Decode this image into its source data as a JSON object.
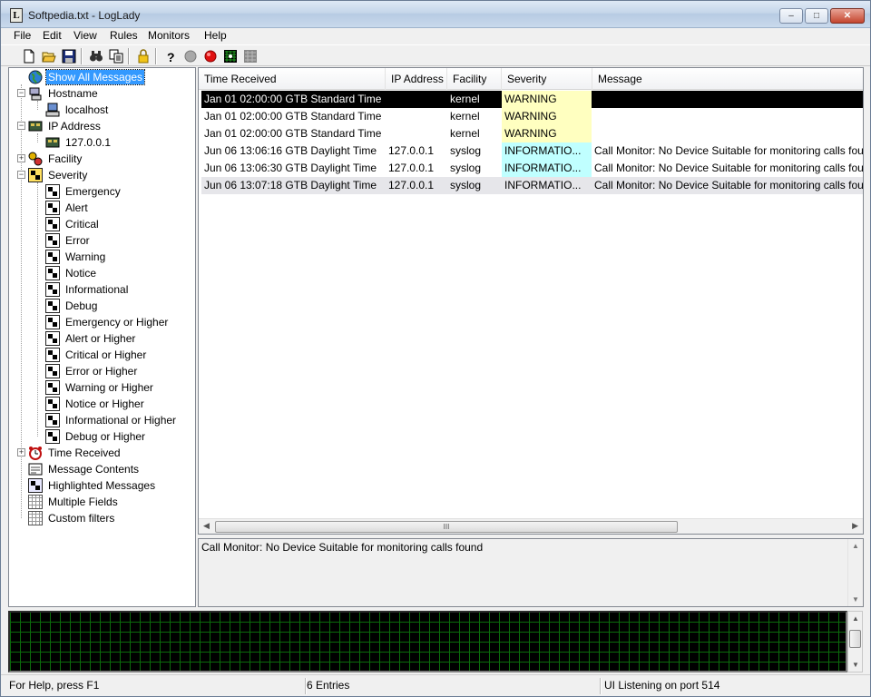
{
  "window": {
    "title": "Softpedia.txt - LogLady",
    "minimize_label": "‒",
    "maximize_label": "□",
    "close_label": "✕"
  },
  "menu": [
    "File",
    "Edit",
    "View",
    "Rules",
    "Monitors",
    "Help"
  ],
  "toolbar": {
    "icons": [
      "new-file-icon",
      "open-folder-icon",
      "save-icon",
      "find-icon",
      "copy-icon",
      "lock-icon",
      "help-icon",
      "stop-gray-icon",
      "record-red-icon",
      "monitor-green-icon",
      "monitor-gray-icon"
    ]
  },
  "tree": {
    "show_all": "Show All Messages",
    "hostname": "Hostname",
    "localhost": "localhost",
    "ip_address": "IP Address",
    "ip": "127.0.0.1",
    "facility": "Facility",
    "severity": "Severity",
    "severity_items": [
      "Emergency",
      "Alert",
      "Critical",
      "Error",
      "Warning",
      "Notice",
      "Informational",
      "Debug",
      "Emergency or Higher",
      "Alert or Higher",
      "Critical or Higher",
      "Error or Higher",
      "Warning or Higher",
      "Notice or Higher",
      "Informational or Higher",
      "Debug or Higher"
    ],
    "time_received": "Time Received",
    "message_contents": "Message Contents",
    "highlighted_messages": "Highlighted Messages",
    "multiple_fields": "Multiple Fields",
    "custom_filters": "Custom filters"
  },
  "list": {
    "columns": [
      "Time Received",
      "IP Address",
      "Facility",
      "Severity",
      "Message"
    ],
    "rows": [
      {
        "time": "Jan 01 02:00:00 GTB Standard Time",
        "ip": "",
        "facility": "kernel",
        "severity": "WARNING",
        "message": ""
      },
      {
        "time": "Jan 01 02:00:00 GTB Standard Time",
        "ip": "",
        "facility": "kernel",
        "severity": "WARNING",
        "message": ""
      },
      {
        "time": "Jan 01 02:00:00 GTB Standard Time",
        "ip": "",
        "facility": "kernel",
        "severity": "WARNING",
        "message": ""
      },
      {
        "time": "Jun 06 13:06:16 GTB Daylight Time",
        "ip": "127.0.0.1",
        "facility": "syslog",
        "severity": "INFORMATIO...",
        "message": "Call Monitor: No Device Suitable for monitoring calls found"
      },
      {
        "time": "Jun 06 13:06:30 GTB Daylight Time",
        "ip": "127.0.0.1",
        "facility": "syslog",
        "severity": "INFORMATIO...",
        "message": "Call Monitor: No Device Suitable for monitoring calls found"
      },
      {
        "time": "Jun 06 13:07:18 GTB Daylight Time",
        "ip": "127.0.0.1",
        "facility": "syslog",
        "severity": "INFORMATIO...",
        "message": "Call Monitor: No Device Suitable for monitoring calls found"
      }
    ],
    "colors": {
      "warning_bg": "#ffffc0",
      "info_bg": "#c0ffff",
      "selected_bg": "#000000",
      "alt_row_bg": "#e6e6ea"
    },
    "hscroll_grip": "III"
  },
  "detail": {
    "text": "Call Monitor: No Device Suitable for monitoring calls found"
  },
  "status": {
    "help": "For Help, press F1",
    "entries": "6 Entries",
    "listening": "UI Listening on port 514"
  }
}
